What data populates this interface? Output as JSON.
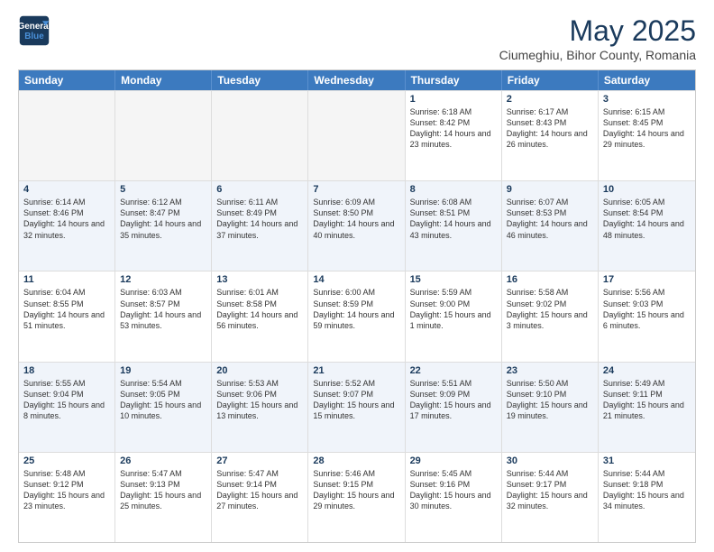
{
  "header": {
    "logo_line1": "General",
    "logo_line2": "Blue",
    "main_title": "May 2025",
    "subtitle": "Ciumeghiu, Bihor County, Romania"
  },
  "weekdays": [
    "Sunday",
    "Monday",
    "Tuesday",
    "Wednesday",
    "Thursday",
    "Friday",
    "Saturday"
  ],
  "rows": [
    [
      {
        "day": "",
        "sunrise": "",
        "sunset": "",
        "daylight": "",
        "empty": true
      },
      {
        "day": "",
        "sunrise": "",
        "sunset": "",
        "daylight": "",
        "empty": true
      },
      {
        "day": "",
        "sunrise": "",
        "sunset": "",
        "daylight": "",
        "empty": true
      },
      {
        "day": "",
        "sunrise": "",
        "sunset": "",
        "daylight": "",
        "empty": true
      },
      {
        "day": "1",
        "sunrise": "Sunrise: 6:18 AM",
        "sunset": "Sunset: 8:42 PM",
        "daylight": "Daylight: 14 hours and 23 minutes."
      },
      {
        "day": "2",
        "sunrise": "Sunrise: 6:17 AM",
        "sunset": "Sunset: 8:43 PM",
        "daylight": "Daylight: 14 hours and 26 minutes."
      },
      {
        "day": "3",
        "sunrise": "Sunrise: 6:15 AM",
        "sunset": "Sunset: 8:45 PM",
        "daylight": "Daylight: 14 hours and 29 minutes."
      }
    ],
    [
      {
        "day": "4",
        "sunrise": "Sunrise: 6:14 AM",
        "sunset": "Sunset: 8:46 PM",
        "daylight": "Daylight: 14 hours and 32 minutes."
      },
      {
        "day": "5",
        "sunrise": "Sunrise: 6:12 AM",
        "sunset": "Sunset: 8:47 PM",
        "daylight": "Daylight: 14 hours and 35 minutes."
      },
      {
        "day": "6",
        "sunrise": "Sunrise: 6:11 AM",
        "sunset": "Sunset: 8:49 PM",
        "daylight": "Daylight: 14 hours and 37 minutes."
      },
      {
        "day": "7",
        "sunrise": "Sunrise: 6:09 AM",
        "sunset": "Sunset: 8:50 PM",
        "daylight": "Daylight: 14 hours and 40 minutes."
      },
      {
        "day": "8",
        "sunrise": "Sunrise: 6:08 AM",
        "sunset": "Sunset: 8:51 PM",
        "daylight": "Daylight: 14 hours and 43 minutes."
      },
      {
        "day": "9",
        "sunrise": "Sunrise: 6:07 AM",
        "sunset": "Sunset: 8:53 PM",
        "daylight": "Daylight: 14 hours and 46 minutes."
      },
      {
        "day": "10",
        "sunrise": "Sunrise: 6:05 AM",
        "sunset": "Sunset: 8:54 PM",
        "daylight": "Daylight: 14 hours and 48 minutes."
      }
    ],
    [
      {
        "day": "11",
        "sunrise": "Sunrise: 6:04 AM",
        "sunset": "Sunset: 8:55 PM",
        "daylight": "Daylight: 14 hours and 51 minutes."
      },
      {
        "day": "12",
        "sunrise": "Sunrise: 6:03 AM",
        "sunset": "Sunset: 8:57 PM",
        "daylight": "Daylight: 14 hours and 53 minutes."
      },
      {
        "day": "13",
        "sunrise": "Sunrise: 6:01 AM",
        "sunset": "Sunset: 8:58 PM",
        "daylight": "Daylight: 14 hours and 56 minutes."
      },
      {
        "day": "14",
        "sunrise": "Sunrise: 6:00 AM",
        "sunset": "Sunset: 8:59 PM",
        "daylight": "Daylight: 14 hours and 59 minutes."
      },
      {
        "day": "15",
        "sunrise": "Sunrise: 5:59 AM",
        "sunset": "Sunset: 9:00 PM",
        "daylight": "Daylight: 15 hours and 1 minute."
      },
      {
        "day": "16",
        "sunrise": "Sunrise: 5:58 AM",
        "sunset": "Sunset: 9:02 PM",
        "daylight": "Daylight: 15 hours and 3 minutes."
      },
      {
        "day": "17",
        "sunrise": "Sunrise: 5:56 AM",
        "sunset": "Sunset: 9:03 PM",
        "daylight": "Daylight: 15 hours and 6 minutes."
      }
    ],
    [
      {
        "day": "18",
        "sunrise": "Sunrise: 5:55 AM",
        "sunset": "Sunset: 9:04 PM",
        "daylight": "Daylight: 15 hours and 8 minutes."
      },
      {
        "day": "19",
        "sunrise": "Sunrise: 5:54 AM",
        "sunset": "Sunset: 9:05 PM",
        "daylight": "Daylight: 15 hours and 10 minutes."
      },
      {
        "day": "20",
        "sunrise": "Sunrise: 5:53 AM",
        "sunset": "Sunset: 9:06 PM",
        "daylight": "Daylight: 15 hours and 13 minutes."
      },
      {
        "day": "21",
        "sunrise": "Sunrise: 5:52 AM",
        "sunset": "Sunset: 9:07 PM",
        "daylight": "Daylight: 15 hours and 15 minutes."
      },
      {
        "day": "22",
        "sunrise": "Sunrise: 5:51 AM",
        "sunset": "Sunset: 9:09 PM",
        "daylight": "Daylight: 15 hours and 17 minutes."
      },
      {
        "day": "23",
        "sunrise": "Sunrise: 5:50 AM",
        "sunset": "Sunset: 9:10 PM",
        "daylight": "Daylight: 15 hours and 19 minutes."
      },
      {
        "day": "24",
        "sunrise": "Sunrise: 5:49 AM",
        "sunset": "Sunset: 9:11 PM",
        "daylight": "Daylight: 15 hours and 21 minutes."
      }
    ],
    [
      {
        "day": "25",
        "sunrise": "Sunrise: 5:48 AM",
        "sunset": "Sunset: 9:12 PM",
        "daylight": "Daylight: 15 hours and 23 minutes."
      },
      {
        "day": "26",
        "sunrise": "Sunrise: 5:47 AM",
        "sunset": "Sunset: 9:13 PM",
        "daylight": "Daylight: 15 hours and 25 minutes."
      },
      {
        "day": "27",
        "sunrise": "Sunrise: 5:47 AM",
        "sunset": "Sunset: 9:14 PM",
        "daylight": "Daylight: 15 hours and 27 minutes."
      },
      {
        "day": "28",
        "sunrise": "Sunrise: 5:46 AM",
        "sunset": "Sunset: 9:15 PM",
        "daylight": "Daylight: 15 hours and 29 minutes."
      },
      {
        "day": "29",
        "sunrise": "Sunrise: 5:45 AM",
        "sunset": "Sunset: 9:16 PM",
        "daylight": "Daylight: 15 hours and 30 minutes."
      },
      {
        "day": "30",
        "sunrise": "Sunrise: 5:44 AM",
        "sunset": "Sunset: 9:17 PM",
        "daylight": "Daylight: 15 hours and 32 minutes."
      },
      {
        "day": "31",
        "sunrise": "Sunrise: 5:44 AM",
        "sunset": "Sunset: 9:18 PM",
        "daylight": "Daylight: 15 hours and 34 minutes."
      }
    ]
  ]
}
